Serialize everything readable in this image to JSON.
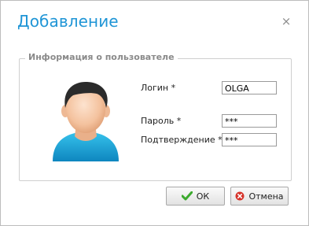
{
  "dialog": {
    "title": "Добавление",
    "close_glyph": "×"
  },
  "group": {
    "legend": "Информация о пользователе"
  },
  "form": {
    "login_label": "Логин *",
    "login_value": "OLGA",
    "password_label": "Пароль *",
    "password_value": "***",
    "confirm_label": "Подтверждение *",
    "confirm_value": "***"
  },
  "buttons": {
    "ok_label": "ОК",
    "cancel_label": "Отмена"
  },
  "icons": {
    "close": "close-icon",
    "avatar": "user-avatar-icon",
    "ok": "checkmark-icon",
    "cancel": "cancel-icon"
  },
  "colors": {
    "title": "#1f95d6",
    "ok_icon": "#3caa2e",
    "cancel_icon": "#d6332a"
  }
}
